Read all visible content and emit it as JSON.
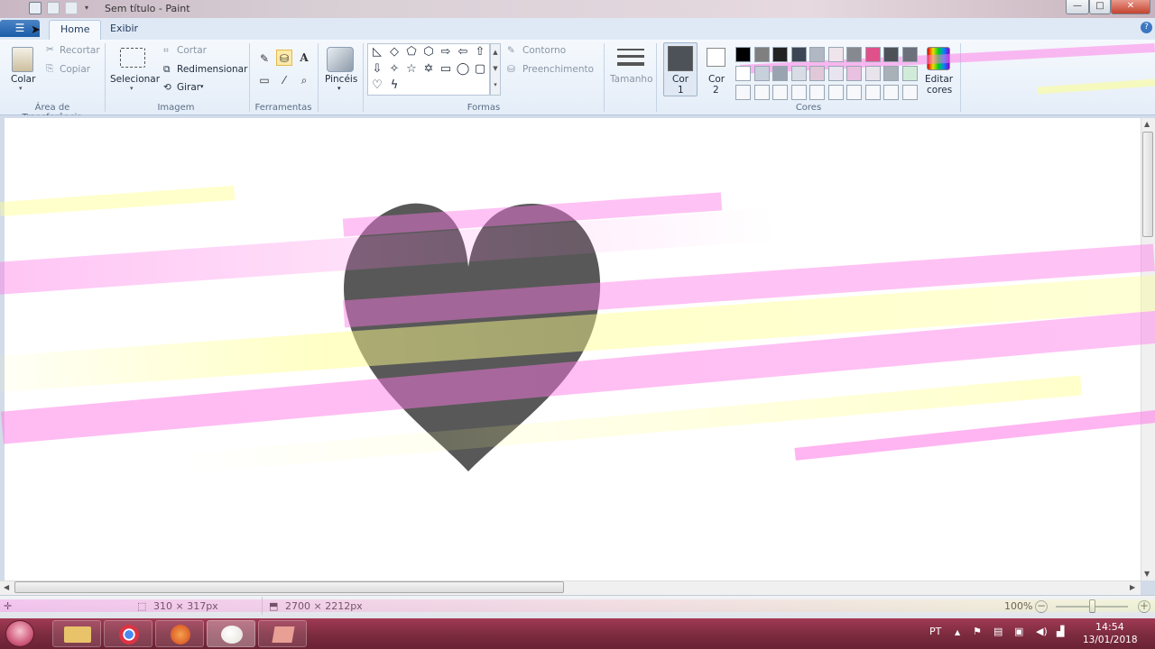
{
  "window": {
    "title": "Sem título - Paint",
    "minimize": "—",
    "maximize": "□",
    "close": "✕"
  },
  "tabs": [
    {
      "label": "Home"
    },
    {
      "label": "Exibir"
    }
  ],
  "ribbon": {
    "clipboard": {
      "group_label": "Área de Transferência",
      "paste": "Colar",
      "cut": "Recortar",
      "copy": "Copiar"
    },
    "image": {
      "group_label": "Imagem",
      "select": "Selecionar",
      "crop": "Cortar",
      "resize": "Redimensionar",
      "rotate": "Girar"
    },
    "tools": {
      "group_label": "Ferramentas",
      "pencil": "✎",
      "fill": "⛁",
      "text": "A",
      "eraser": "▭",
      "picker": "⁄",
      "magnifier": "⌕"
    },
    "brushes": {
      "label": "Pincéis"
    },
    "shapes": {
      "group_label": "Formas",
      "outline": "Contorno",
      "fill": "Preenchimento",
      "items": [
        "◺",
        "◇",
        "⬠",
        "⬡",
        "⇨",
        "⇦",
        "⇧",
        "⇩",
        "✧",
        "☆",
        "✡",
        "▭",
        "◯",
        "▢",
        "♡",
        "ϟ"
      ]
    },
    "size": {
      "label": "Tamanho"
    },
    "colors": {
      "group_label": "Cores",
      "color1_label": "Cor",
      "color1_num": "1",
      "color2_label": "Cor",
      "color2_num": "2",
      "edit_colors_line1": "Editar",
      "edit_colors_line2": "cores",
      "color1_value": "#4d5259",
      "color2_value": "#ffffff",
      "palette_row1": [
        "#000000",
        "#7f7f7f",
        "#222222",
        "#3c4654",
        "#b0b8c4",
        "#f0e4ec",
        "#868a90",
        "#e0508a",
        "#4d5259",
        "#6b707a"
      ],
      "palette_row2": [
        "#ffffff",
        "#c8d0dc",
        "#9aa4b0",
        "#d8dce4",
        "#e0c8d8",
        "#e8e4f0",
        "#e8c0e0",
        "#e8e4ec",
        "#a8b0b8",
        "#d0ecd8"
      ]
    }
  },
  "canvas": {
    "heart_color": "#585858"
  },
  "status": {
    "selection_size": "310 × 317px",
    "canvas_size": "2700 × 2212px",
    "zoom": "100%"
  },
  "taskbar": {
    "language": "PT",
    "time": "14:54",
    "date": "13/01/2018"
  }
}
